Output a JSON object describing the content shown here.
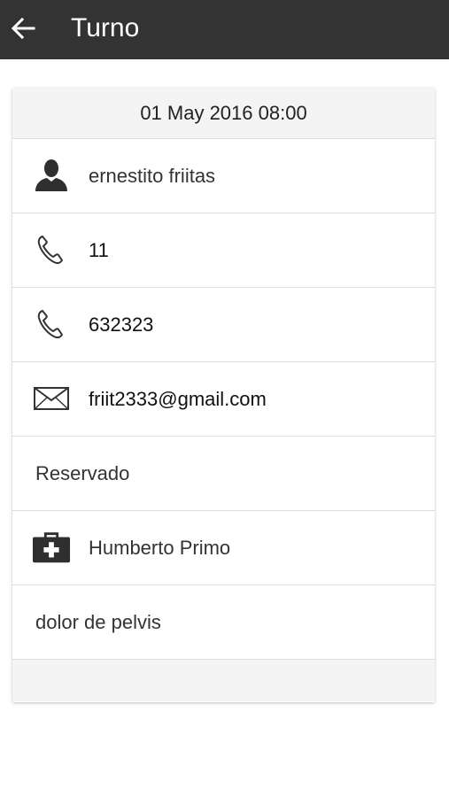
{
  "appbar": {
    "title": "Turno",
    "back_icon": "arrow-back-icon"
  },
  "appointment": {
    "datetime": "01 May 2016 08:00",
    "patient_name": "ernestito friitas",
    "phone_1": "11",
    "phone_2": "632323",
    "email": "friit2333@gmail.com",
    "status": "Reservado",
    "doctor": "Humberto Primo",
    "reason": "dolor de pelvis"
  },
  "icons": {
    "person": "person-icon",
    "phone": "phone-icon",
    "email": "envelope-icon",
    "doctor": "medical-kit-icon"
  },
  "colors": {
    "appbar": "#333333",
    "header_bg": "#f4f4f4"
  }
}
